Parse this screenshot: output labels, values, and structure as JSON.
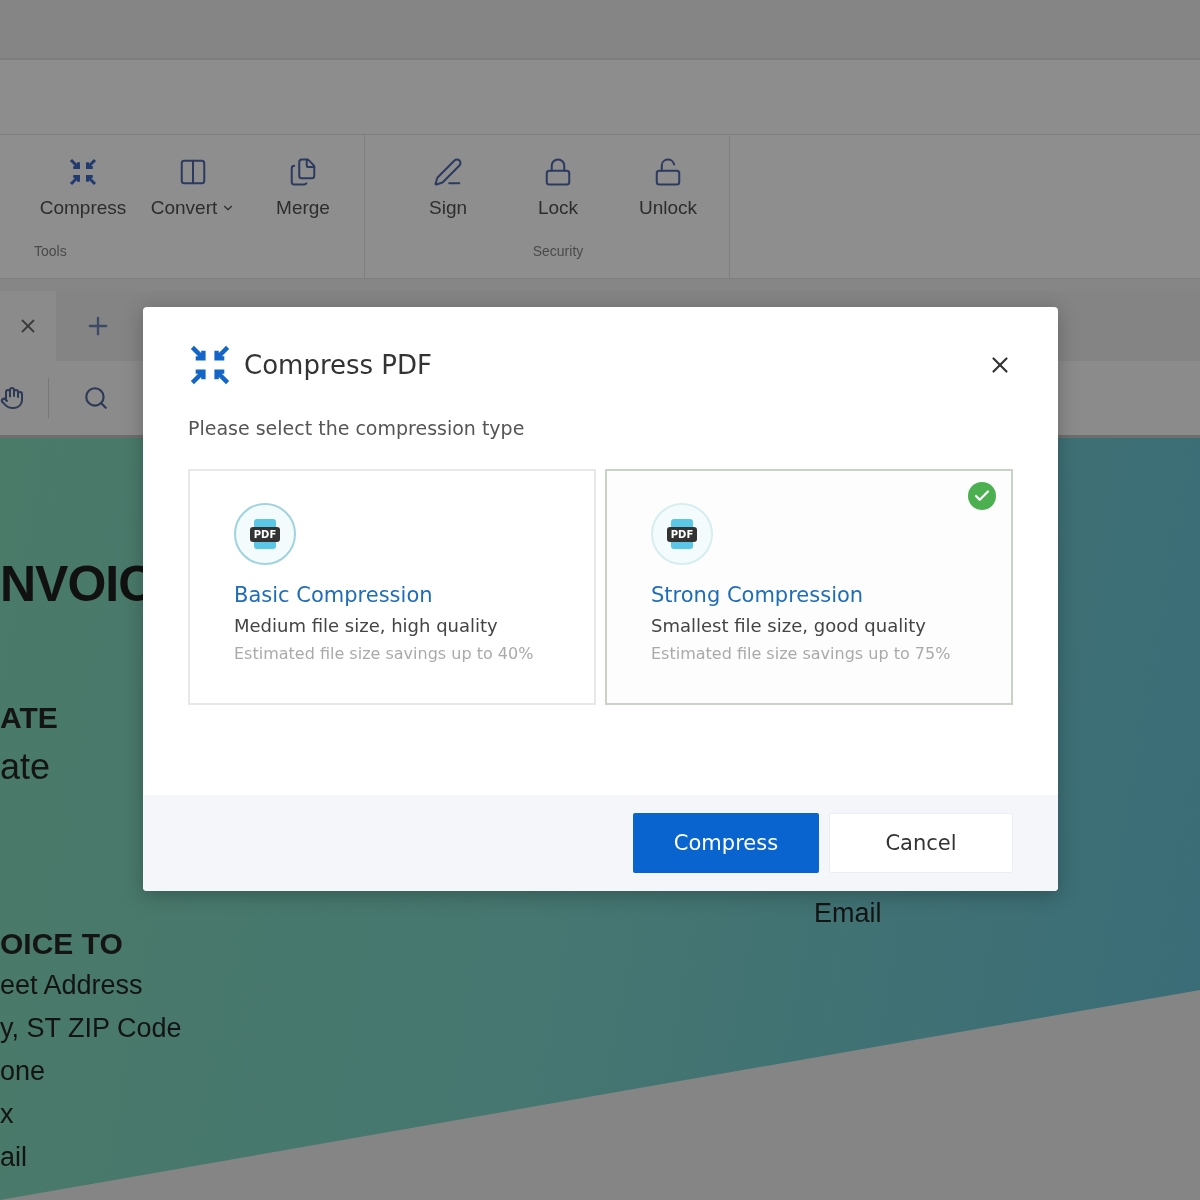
{
  "ribbon": {
    "groups": [
      {
        "label": "Tools",
        "tools": [
          {
            "label": "Compress",
            "dropdown": false
          },
          {
            "label": "Convert",
            "dropdown": true
          },
          {
            "label": "Merge",
            "dropdown": false
          }
        ]
      },
      {
        "label": "Security",
        "tools": [
          {
            "label": "Sign",
            "dropdown": false
          },
          {
            "label": "Lock",
            "dropdown": false
          },
          {
            "label": "Unlock",
            "dropdown": false
          }
        ]
      }
    ]
  },
  "document": {
    "title": "NVOIC",
    "left_lines": [
      {
        "kind": "heading",
        "text": "ATE"
      },
      {
        "kind": "large",
        "text": "ate"
      },
      {
        "kind": "gap"
      },
      {
        "kind": "heading",
        "text": "OICE TO"
      },
      {
        "kind": "body",
        "text": "eet Address"
      },
      {
        "kind": "body",
        "text": "y, ST ZIP Code"
      },
      {
        "kind": "body",
        "text": "one"
      },
      {
        "kind": "body",
        "text": "x"
      },
      {
        "kind": "body",
        "text": "ail"
      }
    ],
    "right_text": "Email"
  },
  "dialog": {
    "title": "Compress PDF",
    "subtitle": "Please select the compression type",
    "options": [
      {
        "title": "Basic Compression",
        "icon_label": "PDF",
        "description": "Medium file size, high quality",
        "savings": "Estimated file size savings up to 40%",
        "selected": false
      },
      {
        "title": "Strong Compression",
        "icon_label": "PDF",
        "description": "Smallest file size, good quality",
        "savings": "Estimated file size savings up to 75%",
        "selected": true
      }
    ],
    "buttons": [
      {
        "label": "Compress",
        "kind": "primary"
      },
      {
        "label": "Cancel",
        "kind": "secondary"
      }
    ]
  }
}
